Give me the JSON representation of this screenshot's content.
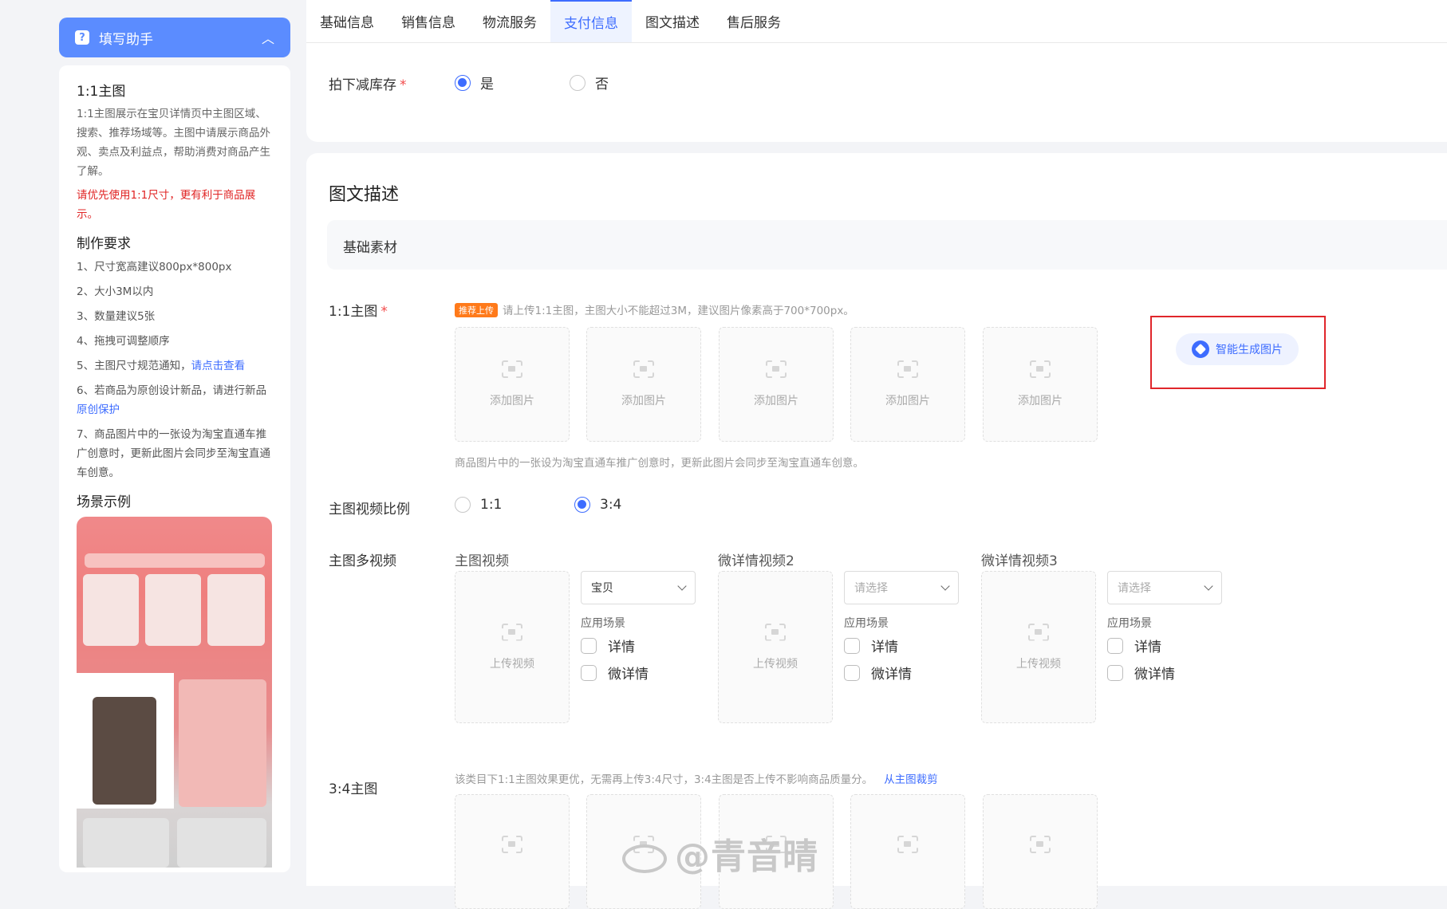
{
  "sidebar": {
    "header_title": "填写助手",
    "main_image_title": "1:1主图",
    "main_image_desc": "1:1主图展示在宝贝详情页中主图区域、搜索、推荐场域等。主图中请展示商品外观、卖点及利益点，帮助消费对商品产生了解。",
    "main_image_warning": "请优先使用1:1尺寸，更有利于商品展示。",
    "requirements_title": "制作要求",
    "req1": "1、尺寸宽高建议800px*800px",
    "req2": "2、大小3M以内",
    "req3": "3、数量建议5张",
    "req4": "4、拖拽可调整顺序",
    "req5_text": "5、主图尺寸规范通知，",
    "req5_link": "请点击查看",
    "req6_text": "6、若商品为原创设计新品，请进行新品",
    "req6_link": "原创保护",
    "req7": "7、商品图片中的一张设为淘宝直通车推广创意时，更新此图片会同步至淘宝直通车创意。",
    "scene_title": "场景示例"
  },
  "tabs": [
    "基础信息",
    "销售信息",
    "物流服务",
    "支付信息",
    "图文描述",
    "售后服务"
  ],
  "active_tab": "支付信息",
  "stock": {
    "label": "拍下减库存",
    "option_yes": "是",
    "option_no": "否",
    "selected": "是"
  },
  "section": {
    "title": "图文描述",
    "subtitle": "基础素材"
  },
  "main_image": {
    "label": "1:1主图",
    "badge": "推荐上传",
    "tip": "请上传1:1主图，主图大小不能超过3M，建议图片像素高于700*700px。",
    "slots": [
      "添加图片",
      "添加图片",
      "添加图片",
      "添加图片",
      "添加图片"
    ],
    "ai_button": "智能生成图片",
    "footer_tip": "商品图片中的一张设为淘宝直通车推广创意时，更新此图片会同步至淘宝直通车创意。"
  },
  "video_ratio": {
    "label": "主图视频比例",
    "option1": "1:1",
    "option2": "3:4",
    "selected": "3:4"
  },
  "multi_video": {
    "label": "主图多视频",
    "upload_text": "上传视频",
    "scene_label": "应用场景",
    "check_detail": "详情",
    "check_micro": "微详情",
    "videos": [
      {
        "title": "主图视频",
        "select_value": "宝贝"
      },
      {
        "title": "微详情视频2",
        "select_value": "请选择"
      },
      {
        "title": "微详情视频3",
        "select_value": "请选择"
      }
    ]
  },
  "image_34": {
    "label": "3:4主图",
    "tip": "该类目下1:1主图效果更优，无需再上传3:4尺寸，3:4主图是否上传不影响商品质量分。",
    "link": "从主图裁剪"
  },
  "watermark": "@青音晴",
  "colors": {
    "accent": "#3d6cff",
    "helper_header": "#5b8cff",
    "required": "#f24a4a",
    "warning": "#e02424",
    "highlight_box": "#e0262b",
    "badge": "#ff7a1a"
  }
}
